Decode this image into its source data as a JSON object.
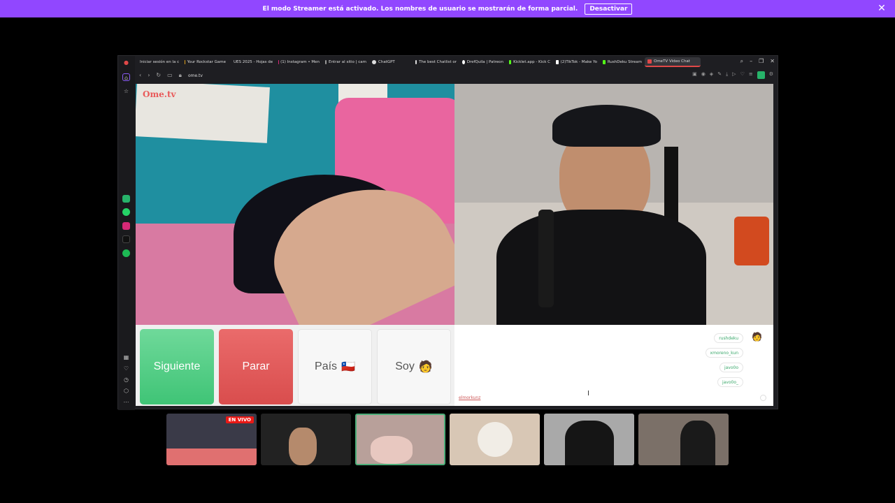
{
  "banner": {
    "message": "El modo Streamer está activado. Los nombres de usuario se mostrarán de forma parcial.",
    "button": "Desactivar"
  },
  "tabs": [
    {
      "label": "Iniciar sesión en la c",
      "color": "#4285f4"
    },
    {
      "label": "Your Rockstar Game",
      "color": "#e2a11b"
    },
    {
      "label": "UES 2025 - Hojas de",
      "color": "#1e9e55"
    },
    {
      "label": "(1) Instagram • Men",
      "color": "#d62976"
    },
    {
      "label": "Entrar al sitio | cam",
      "color": "#999999"
    },
    {
      "label": "ChatGPT",
      "color": "#dddddd"
    },
    {
      "label": "The best Chatlist or",
      "color": "#dddddd"
    },
    {
      "label": "DrefQuila | Patreon",
      "color": "#ffffff"
    },
    {
      "label": "Kicklet.app - Kick C",
      "color": "#53fc18"
    },
    {
      "label": "(2)TikTok - Make Yo",
      "color": "#ffffff"
    },
    {
      "label": "RushDeku Stream",
      "color": "#53fc18"
    },
    {
      "label": "OmeTV Video Chat",
      "color": "#e04848",
      "active": true
    }
  ],
  "address": {
    "url": "ome.tv"
  },
  "video": {
    "logo": "Ome.tv"
  },
  "controls": {
    "next": "Siguiente",
    "stop": "Parar",
    "country": "País",
    "country_emoji": "🇨🇱",
    "iam": "Soy",
    "iam_emoji": "🧑"
  },
  "chat": {
    "messages": [
      "rushdeku",
      "xmoreno_kun",
      "javo0o",
      "javo0o_"
    ],
    "avatar_emoji": "🧑",
    "username": "elmorkunz"
  },
  "thumbs": {
    "live_label": "EN VIVO"
  }
}
